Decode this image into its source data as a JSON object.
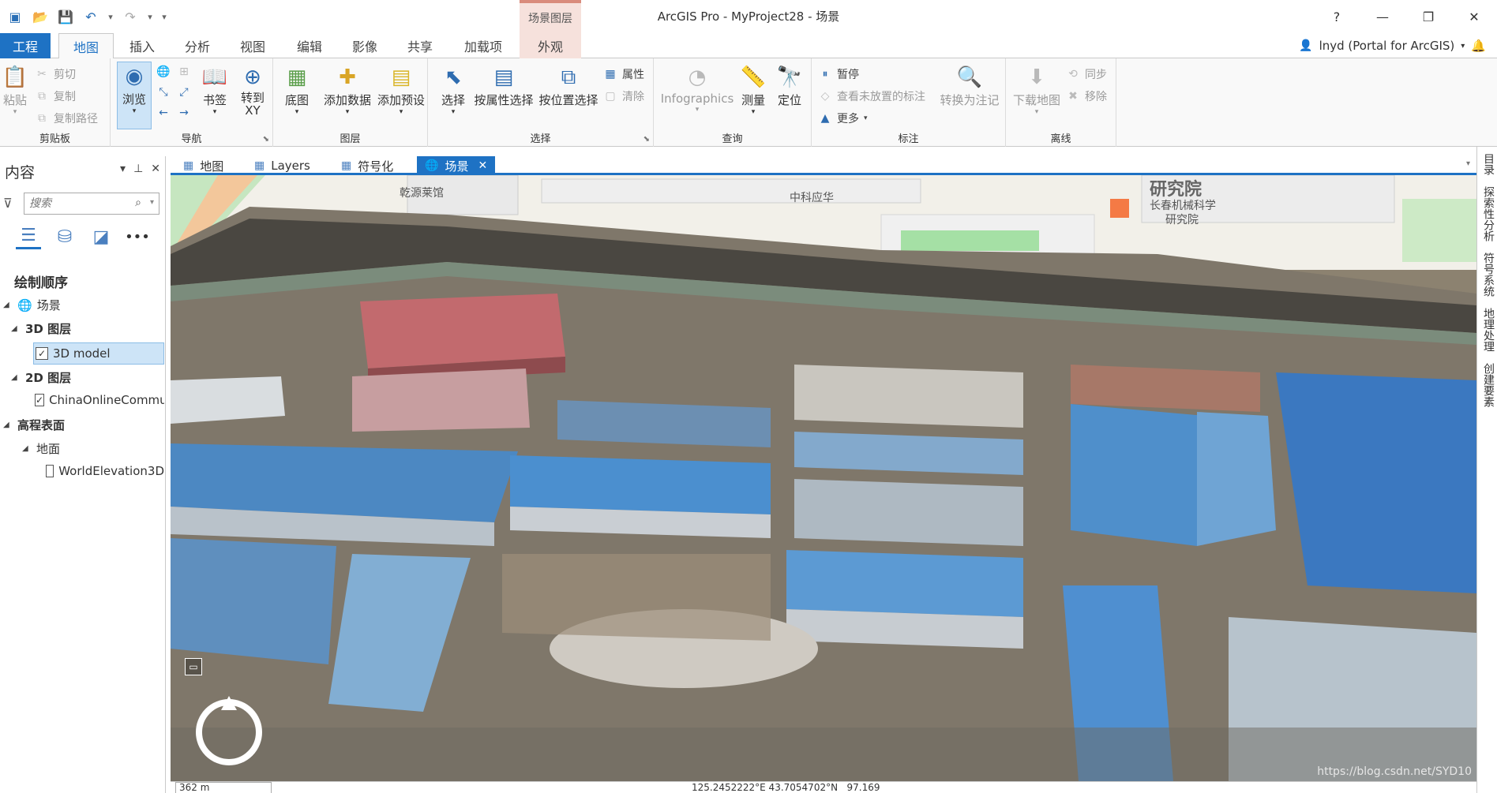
{
  "window": {
    "title": "ArcGIS Pro - MyProject28 - 场景",
    "context_group": "场景图层",
    "help": "?",
    "minimize": "—",
    "restore": "❐",
    "close": "✕"
  },
  "tabs": [
    {
      "label": "工程"
    },
    {
      "label": "地图"
    },
    {
      "label": "插入"
    },
    {
      "label": "分析"
    },
    {
      "label": "视图"
    },
    {
      "label": "编辑"
    },
    {
      "label": "影像"
    },
    {
      "label": "共享"
    },
    {
      "label": "加载项"
    },
    {
      "label": "外观"
    }
  ],
  "user": {
    "name": "lnyd (Portal for ArcGIS)",
    "bell": "🔔"
  },
  "ribbon": {
    "clipboard": {
      "label": "剪贴板",
      "paste": "粘贴",
      "cut": "剪切",
      "copy": "复制",
      "copy_path": "复制路径"
    },
    "navigate": {
      "label": "导航",
      "explore": "浏览",
      "bookmarks": "书签",
      "goto_xy": "转到\nXY"
    },
    "layer": {
      "label": "图层",
      "basemap": "底图",
      "add_data": "添加数据",
      "add_preset": "添加预设"
    },
    "selection": {
      "label": "选择",
      "select": "选择",
      "by_attr": "按属性选择",
      "by_loc": "按位置选择",
      "attributes": "属性",
      "clear": "清除"
    },
    "inquiry": {
      "label": "查询",
      "infographics": "Infographics",
      "measure": "测量",
      "locate": "定位"
    },
    "labeling": {
      "label": "标注",
      "pause": "暂停",
      "view_unplaced": "查看未放置的标注",
      "more": "更多",
      "convert": "转换为注记"
    },
    "offline": {
      "label": "离线",
      "download": "下载地图",
      "sync": "同步",
      "remove": "移除"
    }
  },
  "contents": {
    "title": "内容",
    "search_placeholder": "搜索",
    "draw_order": "绘制顺序",
    "items": [
      {
        "label": "场景"
      },
      {
        "label": "3D 图层"
      },
      {
        "label": "3D model"
      },
      {
        "label": "2D 图层"
      },
      {
        "label": "ChinaOnlineCommunity"
      },
      {
        "label": "高程表面"
      },
      {
        "label": "地面"
      },
      {
        "label": "WorldElevation3D"
      }
    ]
  },
  "view_tabs": [
    {
      "label": "地图"
    },
    {
      "label": "Layers"
    },
    {
      "label": "符号化"
    },
    {
      "label": "场景"
    }
  ],
  "map_labels": {
    "l1": "乾源莱馆",
    "l2": "中科应华",
    "l3": "研究院",
    "l4": "长春机械科学",
    "l5": "研究院"
  },
  "right_dock": [
    "目录",
    "探索性分析",
    "符号系统",
    "地理处理",
    "创建要素"
  ],
  "status": {
    "scale": "362 m",
    "coords": "125.2452222°E 43.7054702°N",
    "elev": "97.169"
  },
  "watermark": "https://blog.csdn.net/SYD10"
}
